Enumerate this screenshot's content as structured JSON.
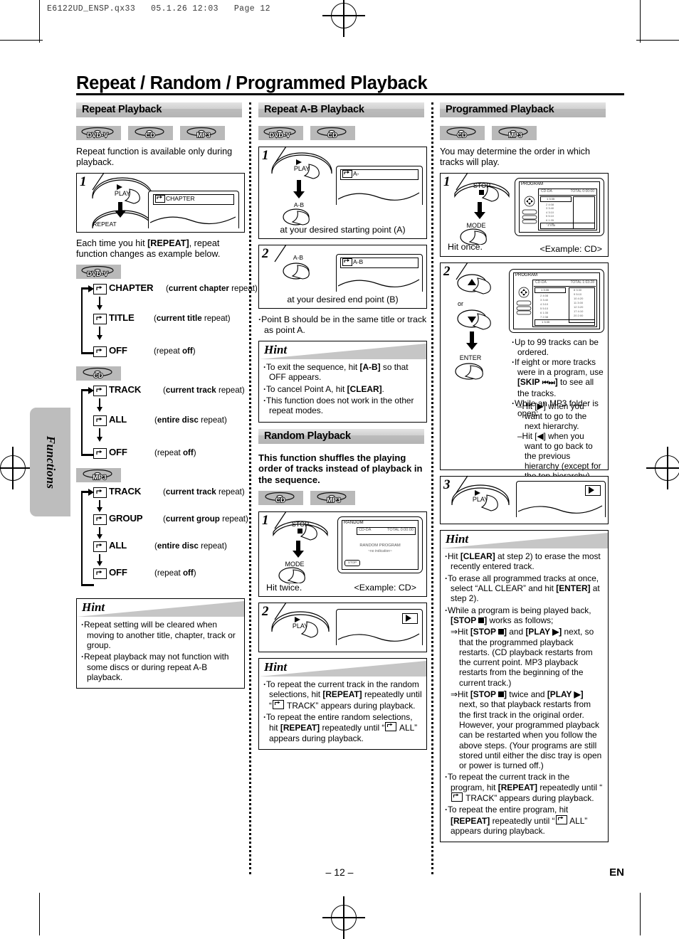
{
  "file_header": "E6122UD_ENSP.qx33   05.1.26 12:03   Page 12",
  "page_title": "Repeat / Random / Programmed Playback",
  "side_tab": "Functions",
  "footer": {
    "page_number": "– 12 –",
    "language": "EN"
  },
  "icons": {
    "repeat": "repeat-icon",
    "play": "play-icon",
    "stop": "stop-icon",
    "skip": "skip-icon"
  },
  "columns": {
    "repeat_playback": {
      "heading": "Repeat Playback",
      "badges": [
        "DVD-V",
        "CD",
        "MP3"
      ],
      "intro": "Repeat function is available only during playback.",
      "step1": {
        "number": "1",
        "key": "PLAY",
        "key2": "REPEAT",
        "display": "CHAPTER"
      },
      "after_step": "Each time you hit [REPEAT], repeat function changes as example below.",
      "after_step_parts": {
        "pre": "Each time you hit ",
        "bold": "[REPEAT]",
        "post": ", repeat function changes as example below."
      },
      "flows": [
        {
          "badge": "DVD-V",
          "rows": [
            {
              "label": "CHAPTER",
              "desc_pre": "(",
              "desc_bold": "current chapter",
              "desc_post": " repeat)"
            },
            {
              "label": "TITLE",
              "desc_pre": "(",
              "desc_bold": "current title",
              "desc_post": " repeat)"
            },
            {
              "label": "OFF",
              "desc_pre": "(repeat ",
              "desc_bold": "off",
              "desc_post": ")"
            }
          ]
        },
        {
          "badge": "CD",
          "rows": [
            {
              "label": "TRACK",
              "desc_pre": "(",
              "desc_bold": "current track",
              "desc_post": " repeat)"
            },
            {
              "label": "ALL",
              "desc_pre": "(",
              "desc_bold": "entire disc",
              "desc_post": " repeat)"
            },
            {
              "label": "OFF",
              "desc_pre": "(repeat ",
              "desc_bold": "off",
              "desc_post": ")"
            }
          ]
        },
        {
          "badge": "MP3",
          "rows": [
            {
              "label": "TRACK",
              "desc_pre": "(",
              "desc_bold": "current track",
              "desc_post": " repeat)"
            },
            {
              "label": "GROUP",
              "desc_pre": "(",
              "desc_bold": "current group",
              "desc_post": " repeat)"
            },
            {
              "label": "ALL",
              "desc_pre": "(",
              "desc_bold": "entire disc",
              "desc_post": " repeat)"
            },
            {
              "label": "OFF",
              "desc_pre": "(repeat ",
              "desc_bold": "off",
              "desc_post": ")"
            }
          ]
        }
      ],
      "hint": {
        "title": "Hint",
        "items": [
          "Repeat setting will be cleared when moving to another title, chapter, track or group.",
          "Repeat playback may not function with some discs or during repeat A-B playback."
        ]
      }
    },
    "repeat_ab": {
      "heading": "Repeat A-B Playback",
      "badges": [
        "DVD-V",
        "CD"
      ],
      "step1": {
        "number": "1",
        "key": "PLAY",
        "key2": "A-B",
        "display": "A-",
        "caption": "at your desired starting point (A)"
      },
      "step2": {
        "number": "2",
        "key": "A-B",
        "display": "A-B",
        "caption": "at your desired end point (B)"
      },
      "note": "Point B should be in the same title or track as point A.",
      "hint": {
        "title": "Hint",
        "items": [
          {
            "pre": "To exit the sequence, hit ",
            "bold": "[A-B]",
            "post": " so that OFF appears."
          },
          {
            "pre": "To cancel Point A, hit ",
            "bold": "[CLEAR]",
            "post": "."
          },
          {
            "pre": "This function does not work in the other repeat modes.",
            "bold": "",
            "post": ""
          }
        ]
      }
    },
    "random": {
      "heading": "Random Playback",
      "intro": "This function shuffles the playing order of tracks instead of playback in the sequence.",
      "badges": [
        "CD",
        "MP3"
      ],
      "step1": {
        "number": "1",
        "key": "STOP",
        "key2": "MODE",
        "caption": "Hit twice.",
        "example": "<Example: CD>",
        "osd": {
          "mode": "RANDOM",
          "disc": "CD-DA",
          "total": "TOTAL 0:00:00",
          "line1": "RANDOM PROGRAM",
          "line2": "~no indication~",
          "badge": "STOP"
        }
      },
      "step2": {
        "number": "2",
        "key": "PLAY",
        "display": "play-icon"
      },
      "hint": {
        "title": "Hint",
        "items": [
          "To repeat the current track in the random selections, hit [REPEAT] repeatedly until “↻ TRACK” appears during playback.",
          "To repeat the entire random selections, hit [REPEAT] repeatedly until “↻ ALL” appears during playback."
        ]
      }
    },
    "programmed": {
      "heading": "Programmed Playback",
      "badges": [
        "CD",
        "MP3"
      ],
      "intro": "You may determine the order in which tracks will play.",
      "step1": {
        "number": "1",
        "key": "STOP",
        "key2": "MODE",
        "caption": "Hit once.",
        "example": "<Example: CD>",
        "osd": {
          "mode": "PROGRAM",
          "disc": "CD-DA",
          "total": "TOTAL 0:00:00"
        }
      },
      "step2": {
        "number": "2",
        "key_up": "up-arrow",
        "key_or": "or",
        "key_down": "down-arrow",
        "key_enter": "ENTER",
        "osd": {
          "mode": "PROGRAM",
          "disc": "CD-DA",
          "total": "TOTAL 1:03:28"
        },
        "notes": [
          "Up to 99 tracks can be ordered.",
          "If eight or more tracks were in a program, use [SKIP ⏮ ⏭] to see all the tracks.",
          "While an MP3 folder is open:"
        ],
        "subnotes": [
          "–Hit [▶] when you want to go to the next hierarchy.",
          "–Hit [◀] when you want to go back to the previous hierarchy (except for the top hierarchy)."
        ]
      },
      "step3": {
        "number": "3",
        "key": "PLAY",
        "display": "play-icon"
      },
      "hint": {
        "title": "Hint",
        "items": [
          "Hit [CLEAR] at step 2) to erase the most recently entered track.",
          "To erase all programmed tracks at once, select “ALL CLEAR” and hit [ENTER] at step 2).",
          "While a program is being played back, [STOP ■] works as follows;",
          "⇒Hit [STOP ■] and [PLAY ▶] next, so that the programmed playback restarts. (CD playback restarts from the current point. MP3 playback restarts from the beginning of the current track.)",
          "⇒Hit [STOP ■] twice and [PLAY ▶] next, so that playback restarts from the first track in the original order. However, your programmed playback can be restarted when you follow the above steps. (Your programs are still stored until either the disc tray is open or power is turned off.)",
          "To repeat the current track in the program, hit [REPEAT] repeatedly until “↻ TRACK” appears during playback.",
          "To repeat the entire program, hit [REPEAT] repeatedly until “↻ ALL” appears during playback."
        ]
      }
    }
  },
  "program_list": {
    "left_tracks": [
      "1  3:35",
      "2  4:08",
      "3  3:40",
      "4  3:10",
      "5  5:10",
      "6  1:35",
      "7  2:38"
    ],
    "right_tracks": [
      "8   3:30",
      "9   5:10",
      "10  4:20",
      "11  3:00",
      "12  3:20",
      "17  4:10",
      "20  2:00"
    ],
    "selected": "1  3:35",
    "page_left": "1/4",
    "page_right": "1/1",
    "buttons": [
      "ENTER",
      "PLAY",
      "CLEAR"
    ]
  }
}
